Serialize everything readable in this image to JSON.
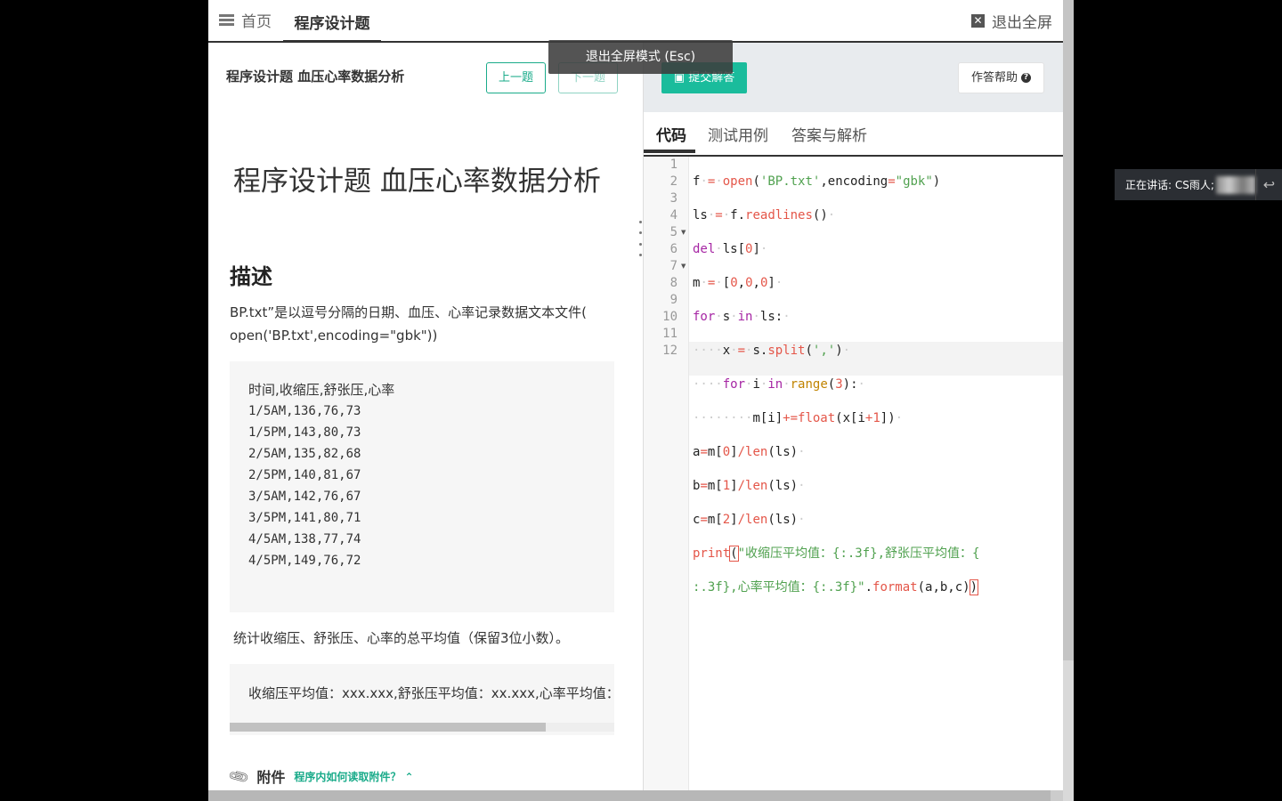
{
  "nav": {
    "home_label": "首页",
    "active_tab": "程序设计题",
    "exit_fullscreen": "退出全屏"
  },
  "fullscreen_tooltip": "退出全屏模式 (Esc)",
  "question": {
    "header_title": "程序设计题 血压心率数据分析",
    "prev_button": "上一题",
    "next_button": "下一题",
    "big_title": "程序设计题 血压心率数据分析",
    "desc_heading": "描述",
    "desc_line1": "BP.txt”是以逗号分隔的日期、血压、心率记录数据文本文件(",
    "desc_line2": "open('BP.txt',encoding=\"gbk\"))",
    "data_lines": [
      "时间,收缩压,舒张压,心率",
      "1/5AM,136,76,73",
      "1/5PM,143,80,73",
      "2/5AM,135,82,68",
      "2/5PM,140,81,67",
      "3/5AM,142,76,67",
      "3/5PM,141,80,71",
      "4/5AM,138,77,74",
      "4/5PM,149,76,72"
    ],
    "task_text": "统计收缩压、舒张压、心率的总平均值（保留3位小数）。",
    "output_example": "收缩压平均值：xxx.xxx,舒张压平均值：xx.xxx,心率平均值：xx.xxx",
    "attach_title": "附件",
    "attach_link": "程序内如何读取附件？ ⌃"
  },
  "editor": {
    "submit_button": "提交解答",
    "help_button": "作答帮助",
    "tabs": [
      "代码",
      "测试用例",
      "答案与解析"
    ],
    "line_numbers": [
      "1",
      "2",
      "3",
      "4",
      "5",
      "6",
      "7",
      "8",
      "9",
      "10",
      "11",
      "12"
    ]
  },
  "speaking": {
    "label": "正在讲话: CS雨人;"
  },
  "colors": {
    "accent": "#1abc9c",
    "keyword": "#a626a4",
    "string": "#50a14f",
    "number": "#e45649",
    "function": "#c18401"
  }
}
